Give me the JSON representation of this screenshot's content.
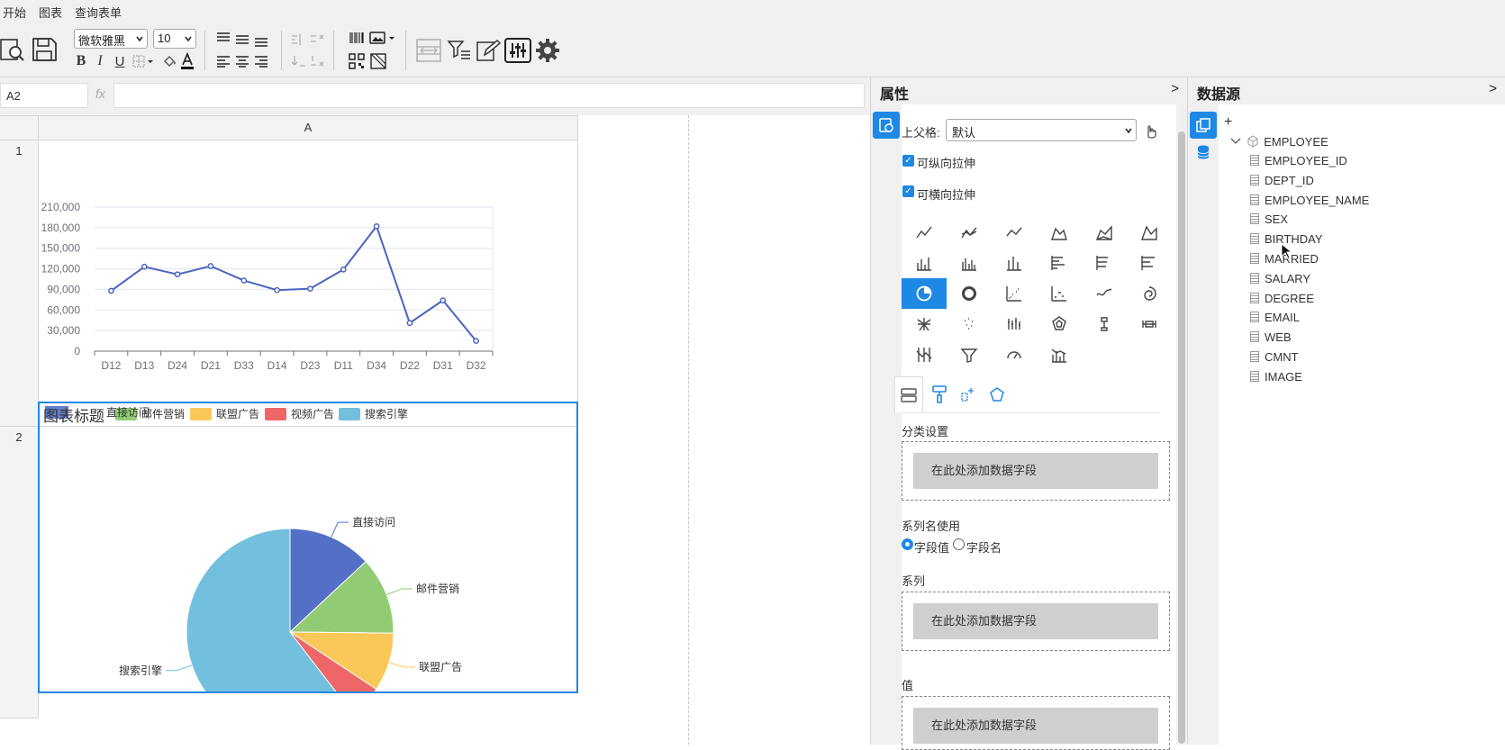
{
  "menu": {
    "tabs": [
      "开始",
      "图表",
      "查询表单"
    ],
    "active": 0
  },
  "toolbar": {
    "font_family": "微软雅黑",
    "font_size": "10"
  },
  "formula": {
    "cell_ref": "A2",
    "fx": "fx",
    "value": ""
  },
  "sheet": {
    "column_headers": [
      "A"
    ],
    "row_headers": [
      "1",
      "2"
    ]
  },
  "line_chart": {
    "y_ticks": [
      "210,000",
      "180,000",
      "150,000",
      "120,000",
      "90,000",
      "60,000",
      "30,000",
      "0"
    ]
  },
  "pie_chart": {
    "title_overlay": "图表标题",
    "legend_partial": "直接访问"
  },
  "chart_data": [
    {
      "type": "line",
      "categories": [
        "D12",
        "D13",
        "D24",
        "D21",
        "D33",
        "D14",
        "D23",
        "D11",
        "D34",
        "D22",
        "D31",
        "D32"
      ],
      "series": [
        {
          "values": [
            88000,
            123000,
            112000,
            124000,
            103000,
            89000,
            91000,
            119000,
            182000,
            41000,
            74000,
            15000
          ]
        }
      ],
      "ylim": [
        0,
        210000
      ],
      "grid": true,
      "color": "#4b64c0"
    },
    {
      "type": "pie",
      "title": "图表标题",
      "legend_placement": "top",
      "slices": [
        {
          "label": "直接访问",
          "value": 335,
          "color": "#5470c6"
        },
        {
          "label": "邮件营销",
          "value": 310,
          "color": "#91cc75"
        },
        {
          "label": "联盟广告",
          "value": 234,
          "color": "#fac858"
        },
        {
          "label": "视频广告",
          "value": 135,
          "color": "#ee6666"
        },
        {
          "label": "搜索引擎",
          "value": 1548,
          "color": "#73c0de"
        }
      ]
    }
  ],
  "properties": {
    "title": "属性",
    "collapse": ">",
    "parent_label": "上父格:",
    "parent_value": "默认",
    "stretch_v": "可纵向拉伸",
    "stretch_h": "可横向拉伸",
    "category_section": "分类设置",
    "add_field": "在此处添加数据字段",
    "series_name_use": "系列名使用",
    "radio_value": "字段值",
    "radio_name": "字段名",
    "series_section": "系列",
    "value_section": "值"
  },
  "datasource": {
    "title": "数据源",
    "collapse": ">",
    "add": "+",
    "table": "EMPLOYEE",
    "fields": [
      "EMPLOYEE_ID",
      "DEPT_ID",
      "EMPLOYEE_NAME",
      "SEX",
      "BIRTHDAY",
      "MARRIED",
      "SALARY",
      "DEGREE",
      "EMAIL",
      "WEB",
      "CMNT",
      "IMAGE"
    ]
  }
}
